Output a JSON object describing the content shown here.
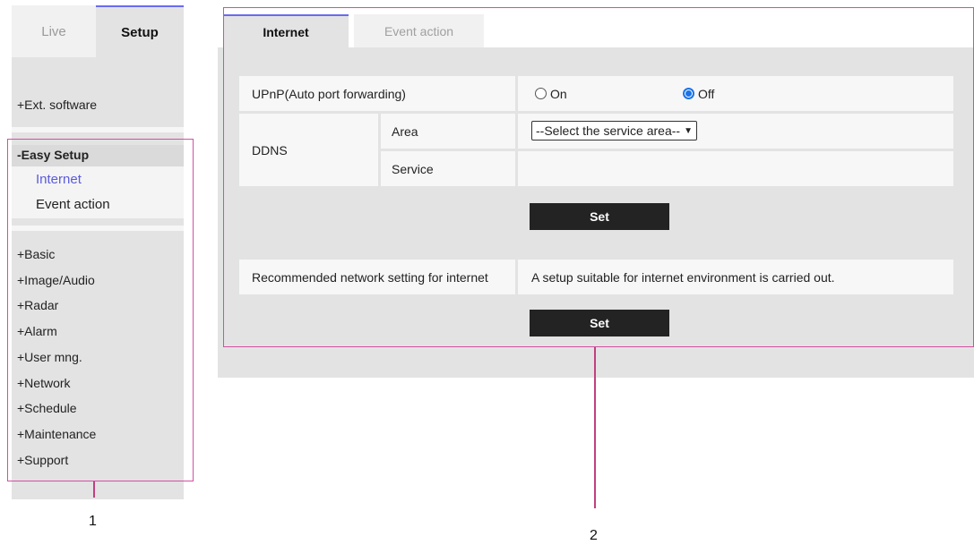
{
  "top_tabs": {
    "live": "Live",
    "setup": "Setup"
  },
  "sidebar": {
    "ext_software": "+Ext. software",
    "easy_setup": "-Easy Setup",
    "easy_items": [
      "Internet",
      "Event action"
    ],
    "items": [
      "+Basic",
      "+Image/Audio",
      "+Radar",
      "+Alarm",
      "+User mng.",
      "+Network",
      "+Schedule",
      "+Maintenance",
      "+Support"
    ]
  },
  "main": {
    "tabs": [
      "Internet",
      "Event action"
    ],
    "upnp": {
      "label": "UPnP(Auto port forwarding)",
      "on": "On",
      "off": "Off",
      "selected": "Off"
    },
    "ddns": {
      "label": "DDNS",
      "area_label": "Area",
      "area_value": "--Select the service area--",
      "service_label": "Service",
      "service_value": ""
    },
    "set_label": "Set",
    "recommended": {
      "label": "Recommended network setting for internet",
      "description": "A setup suitable for internet environment is carried out."
    },
    "set_label_2": "Set"
  },
  "callouts": {
    "one": "1",
    "two": "2"
  },
  "colors": {
    "accent": "#6a6af0",
    "callout": "#d24fa3",
    "button": "#232323",
    "active_link": "#5b5bdc"
  }
}
